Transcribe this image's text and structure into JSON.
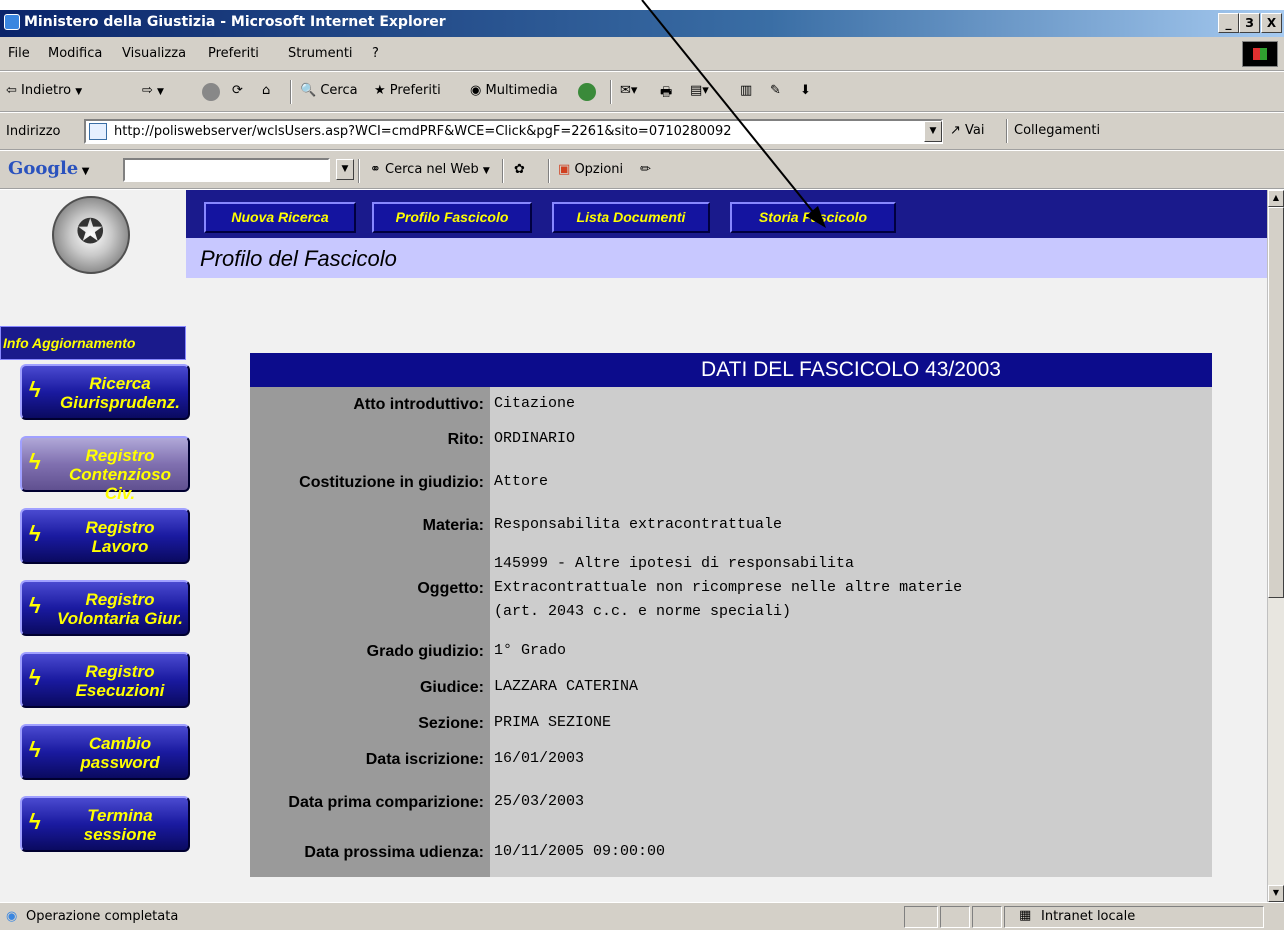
{
  "window": {
    "title": "Ministero della Giustizia - Microsoft Internet Explorer",
    "minimize": "_",
    "maximize": "З",
    "close": "X"
  },
  "menubar": {
    "items": [
      "File",
      "Modifica",
      "Visualizza",
      "Preferiti",
      "Strumenti",
      "?"
    ]
  },
  "toolbar": {
    "back": "Indietro",
    "search": "Cerca",
    "favorites": "Preferiti",
    "multimedia": "Multimedia"
  },
  "address": {
    "label": "Indirizzo",
    "url": "http://poliswebserver/wclsUsers.asp?WCI=cmdPRF&WCE=Click&pgF=2261&sito=0710280092",
    "go": "Vai",
    "links": "Collegamenti"
  },
  "googlebar": {
    "logo": "Google",
    "search_web": "Cerca nel Web",
    "options": "Opzioni"
  },
  "page": {
    "nav": [
      "Nuova Ricerca",
      "Profilo Fascicolo",
      "Lista Documenti",
      "Storia Fascicolo"
    ],
    "subtitle": "Profilo del Fascicolo",
    "info_update": "Info Aggiornamento",
    "sidebar": [
      {
        "line1": "Ricerca",
        "line2": "Giurisprudenz."
      },
      {
        "line1": "Registro",
        "line2": "Contenzioso Civ."
      },
      {
        "line1": "Registro",
        "line2": "Lavoro"
      },
      {
        "line1": "Registro",
        "line2": "Volontaria Giur."
      },
      {
        "line1": "Registro",
        "line2": "Esecuzioni"
      },
      {
        "line1": "Cambio",
        "line2": "password"
      },
      {
        "line1": "Termina",
        "line2": "sessione"
      }
    ]
  },
  "fascicolo": {
    "header": "DATI DEL FASCICOLO 43/2003",
    "rows": [
      {
        "label": "Atto introduttivo:",
        "value": "Citazione"
      },
      {
        "label": "Rito:",
        "value": "ORDINARIO"
      },
      {
        "label": "Costituzione in giudizio:",
        "value": "Attore"
      },
      {
        "label": "Materia:",
        "value": "Responsabilita extracontrattuale"
      },
      {
        "label": "Oggetto:",
        "value": "145999 - Altre ipotesi di responsabilita\nExtracontrattuale non ricomprese nelle altre materie\n(art. 2043 c.c. e norme speciali)"
      },
      {
        "label": "Grado giudizio:",
        "value": "1° Grado"
      },
      {
        "label": "Giudice:",
        "value": "LAZZARA CATERINA"
      },
      {
        "label": "Sezione:",
        "value": "PRIMA SEZIONE"
      },
      {
        "label": "Data iscrizione:",
        "value": "16/01/2003"
      },
      {
        "label": "Data prima comparizione:",
        "value": "25/03/2003"
      },
      {
        "label": "Data prossima udienza:",
        "value": "10/11/2005 09:00:00"
      }
    ]
  },
  "status": {
    "text": "Operazione completata",
    "zone": "Intranet locale"
  }
}
